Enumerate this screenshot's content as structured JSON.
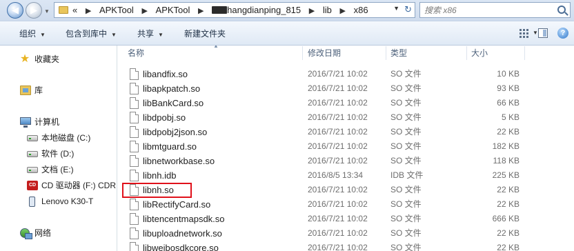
{
  "address_bar": {
    "overflow_marker": "«",
    "crumbs": [
      "APKTool",
      "APKTool",
      "hangdianping_815",
      "lib",
      "x86"
    ],
    "search_placeholder": "搜索 x86"
  },
  "toolbar": {
    "organize_label": "组织",
    "include_label": "包含到库中",
    "share_label": "共享",
    "new_folder_label": "新建文件夹",
    "help_icon_glyph": "?"
  },
  "nav_pane": {
    "favorites_label": "收藏夹",
    "libraries_label": "库",
    "computer_label": "计算机",
    "drives": [
      {
        "label": "本地磁盘 (C:)",
        "icon": "hard-drive-icon"
      },
      {
        "label": "软件 (D:)",
        "icon": "hard-drive-icon"
      },
      {
        "label": "文档 (E:)",
        "icon": "hard-drive-icon"
      },
      {
        "label": "CD 驱动器 (F:) CDR",
        "icon": "cd-drive-icon"
      },
      {
        "label": "Lenovo K30-T",
        "icon": "phone-icon"
      }
    ],
    "network_label": "网络"
  },
  "columns": {
    "name": "名称",
    "date": "修改日期",
    "type": "类型",
    "size": "大小"
  },
  "files": [
    {
      "name": "libandfix.so",
      "date": "2016/7/21 10:02",
      "type": "SO 文件",
      "size": "10 KB"
    },
    {
      "name": "libapkpatch.so",
      "date": "2016/7/21 10:02",
      "type": "SO 文件",
      "size": "93 KB"
    },
    {
      "name": "libBankCard.so",
      "date": "2016/7/21 10:02",
      "type": "SO 文件",
      "size": "66 KB"
    },
    {
      "name": "libdpobj.so",
      "date": "2016/7/21 10:02",
      "type": "SO 文件",
      "size": "5 KB"
    },
    {
      "name": "libdpobj2json.so",
      "date": "2016/7/21 10:02",
      "type": "SO 文件",
      "size": "22 KB"
    },
    {
      "name": "libmtguard.so",
      "date": "2016/7/21 10:02",
      "type": "SO 文件",
      "size": "182 KB"
    },
    {
      "name": "libnetworkbase.so",
      "date": "2016/7/21 10:02",
      "type": "SO 文件",
      "size": "118 KB"
    },
    {
      "name": "libnh.idb",
      "date": "2016/8/5 13:34",
      "type": "IDB 文件",
      "size": "225 KB"
    },
    {
      "name": "libnh.so",
      "date": "2016/7/21 10:02",
      "type": "SO 文件",
      "size": "22 KB"
    },
    {
      "name": "libRectifyCard.so",
      "date": "2016/7/21 10:02",
      "type": "SO 文件",
      "size": "22 KB"
    },
    {
      "name": "libtencentmapsdk.so",
      "date": "2016/7/21 10:02",
      "type": "SO 文件",
      "size": "666 KB"
    },
    {
      "name": "libuploadnetwork.so",
      "date": "2016/7/21 10:02",
      "type": "SO 文件",
      "size": "22 KB"
    },
    {
      "name": "libweibosdkcore.so",
      "date": "2016/7/21 10:02",
      "type": "SO 文件",
      "size": "22 KB"
    }
  ],
  "highlighted_file": "libnh.so",
  "colors": {
    "highlight_border": "#e0101a",
    "toolbar_bg": "#dfe9f5",
    "accent": "#3f6fa8"
  }
}
